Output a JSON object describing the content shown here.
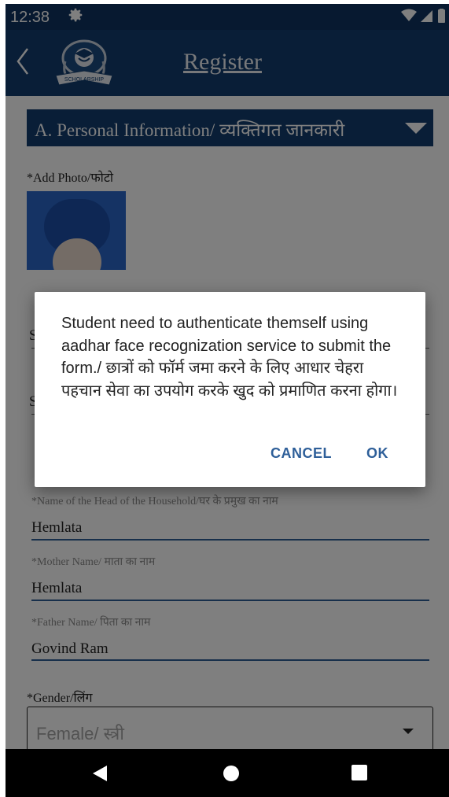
{
  "status_bar": {
    "time": "12:38",
    "icons": [
      "gear-icon",
      "wifi-icon",
      "signal-icon",
      "battery-icon"
    ]
  },
  "app_bar": {
    "title": "Register",
    "logo_text": "SCHOLARSHIP"
  },
  "section": {
    "label": "A. Personal Information/ व्यक्तिगत जानकारी"
  },
  "photo": {
    "label": "*Add Photo/फोटो"
  },
  "fields": [
    {
      "label": "*Name of the Head of the Household/घर के प्रमुख का नाम",
      "value": "Hemlata"
    },
    {
      "label": "*Mother Name/ माता का नाम",
      "value": "Hemlata"
    },
    {
      "label": "*Father Name/ पिता का नाम",
      "value": "Govind Ram"
    }
  ],
  "gender": {
    "label": "*Gender/लिंग",
    "value": "Female/ स्त्री"
  },
  "dialog": {
    "message": "Student need to authenticate themself using aadhar face recognization service to submit the form./ छात्रों को फॉर्म जमा करने के लिए आधार चेहरा पहचान सेवा का उपयोग करके खुद को प्रमाणित करना होगा।",
    "cancel_label": "CANCEL",
    "ok_label": "OK"
  },
  "colors": {
    "primary": "#123d6f",
    "status_bar": "#0e3360",
    "accent": "#2e5f99",
    "scrim": "rgba(0,0,0,0.5)"
  }
}
